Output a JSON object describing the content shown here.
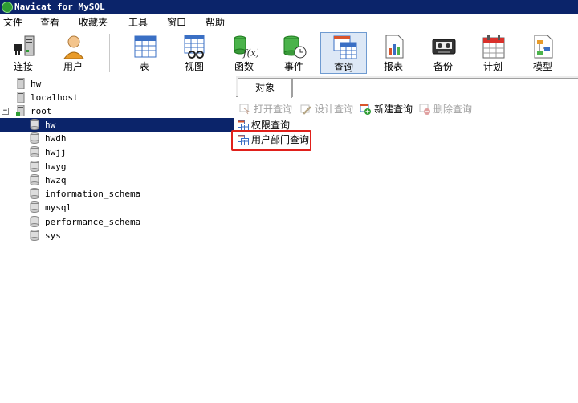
{
  "window": {
    "title": "Navicat for MySQL"
  },
  "menu": {
    "items": [
      "文件",
      "查看",
      "收藏夹",
      "工具",
      "窗口",
      "帮助"
    ]
  },
  "toolbar": {
    "buttons": [
      {
        "label": "连接",
        "icon": "connection-icon"
      },
      {
        "label": "用户",
        "icon": "user-icon"
      },
      {
        "label": "表",
        "icon": "table-icon"
      },
      {
        "label": "视图",
        "icon": "view-icon"
      },
      {
        "label": "函数",
        "icon": "function-icon"
      },
      {
        "label": "事件",
        "icon": "event-icon"
      },
      {
        "label": "查询",
        "icon": "query-icon",
        "active": true
      },
      {
        "label": "报表",
        "icon": "report-icon"
      },
      {
        "label": "备份",
        "icon": "backup-icon"
      },
      {
        "label": "计划",
        "icon": "schedule-icon"
      },
      {
        "label": "模型",
        "icon": "model-icon"
      }
    ]
  },
  "tree": {
    "connections": [
      {
        "label": "hw"
      },
      {
        "label": "localhost"
      },
      {
        "label": "root",
        "expanded": true
      }
    ],
    "databases": [
      "hw",
      "hwdh",
      "hwjj",
      "hwyg",
      "hwzq",
      "information_schema",
      "mysql",
      "performance_schema",
      "sys"
    ],
    "selected": "hw"
  },
  "tabs": {
    "objects_label": "对象"
  },
  "actions": {
    "open": "打开查询",
    "design": "设计查询",
    "new": "新建查询",
    "delete": "删除查询"
  },
  "queries": [
    "权限查询",
    "用户部门查询"
  ],
  "colors": {
    "titlebar": "#0b246a",
    "selection": "#0b246a",
    "highlight": "#e0201b",
    "accent_green": "#2e9c33"
  }
}
